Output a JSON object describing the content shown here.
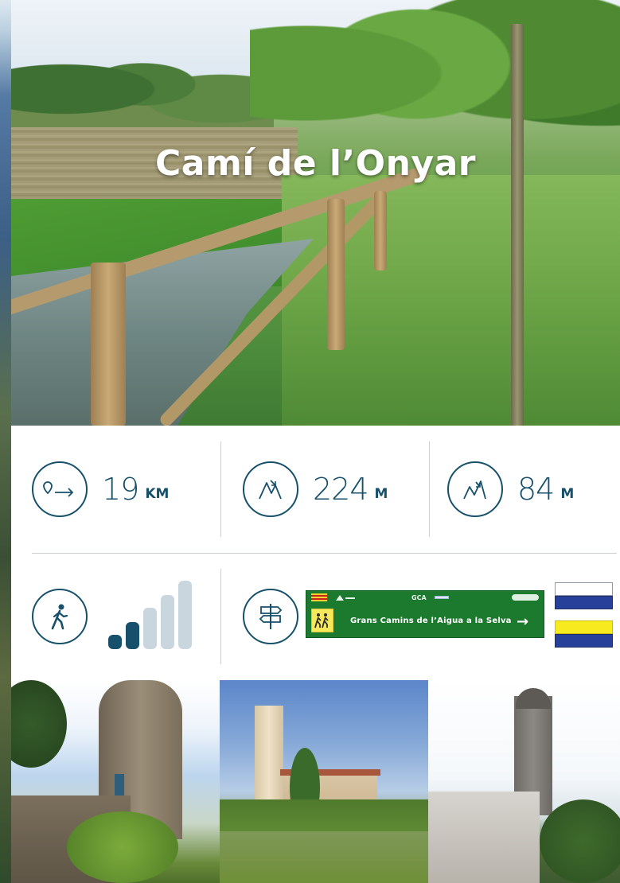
{
  "hero": {
    "title": "Camí de l’Onyar"
  },
  "stats": {
    "distance": {
      "value": "19",
      "unit": "KM",
      "icon": "route-distance-icon"
    },
    "ascent": {
      "value": "224",
      "unit": "M",
      "icon": "elevation-gain-icon"
    },
    "descent": {
      "value": "84",
      "unit": "M",
      "icon": "elevation-loss-icon"
    }
  },
  "difficulty": {
    "icon": "hiker-icon",
    "level": 2,
    "max": 5,
    "active_color": "#16506b",
    "inactive_color": "#c9d6dd"
  },
  "signage": {
    "icon": "signpost-icon",
    "sign": {
      "code": "GCA",
      "route_name": "Grans Camins de l’Aigua a la Selva",
      "arrow": "→",
      "background": "#1c7a2e"
    },
    "trail_marks": [
      {
        "top": "white",
        "bottom": "blue",
        "colors": [
          "#ffffff",
          "#27419a"
        ]
      },
      {
        "top": "yellow",
        "bottom": "blue",
        "colors": [
          "#f7ea1e",
          "#27419a"
        ]
      }
    ]
  },
  "colors": {
    "primary": "#16506b",
    "card": "#ffffff",
    "divider": "#c9cfd3"
  }
}
